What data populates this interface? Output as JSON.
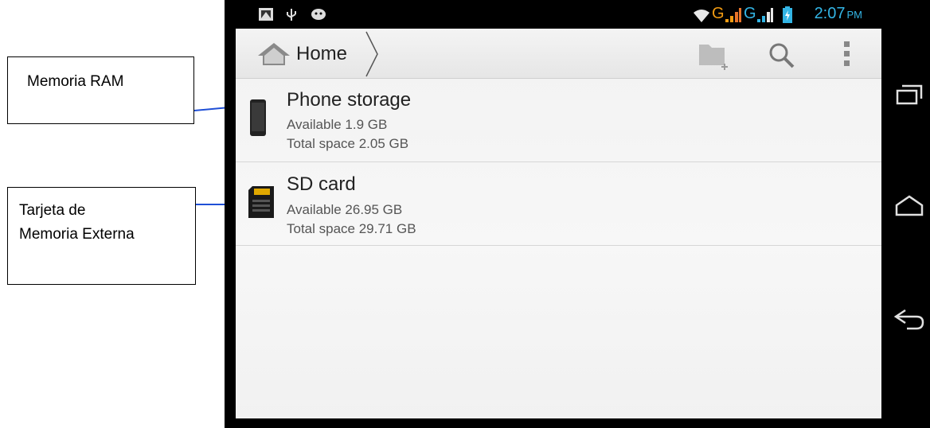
{
  "annotations": {
    "ram_label": "Memoria RAM",
    "sd_label_line1": "Tarjeta de",
    "sd_label_line2": "Memoria Externa"
  },
  "status_bar": {
    "network_label_1": "G",
    "network_label_2": "G",
    "time": "2:07",
    "ampm": "PM"
  },
  "action_bar": {
    "title": "Home",
    "icons": [
      "home-icon",
      "new-folder-icon",
      "search-icon",
      "overflow-menu-icon"
    ]
  },
  "storage_list": [
    {
      "name": "Phone storage",
      "available": "Available 1.9 GB",
      "total": "Total space 2.05 GB",
      "icon": "phone-icon"
    },
    {
      "name": "SD card",
      "available": "Available 26.95 GB",
      "total": "Total space 29.71 GB",
      "icon": "sd-card-icon"
    }
  ],
  "colors": {
    "accent": "#33b5e5",
    "signal_orange": "#f39c12",
    "arrow_blue": "#1f4fd6"
  }
}
